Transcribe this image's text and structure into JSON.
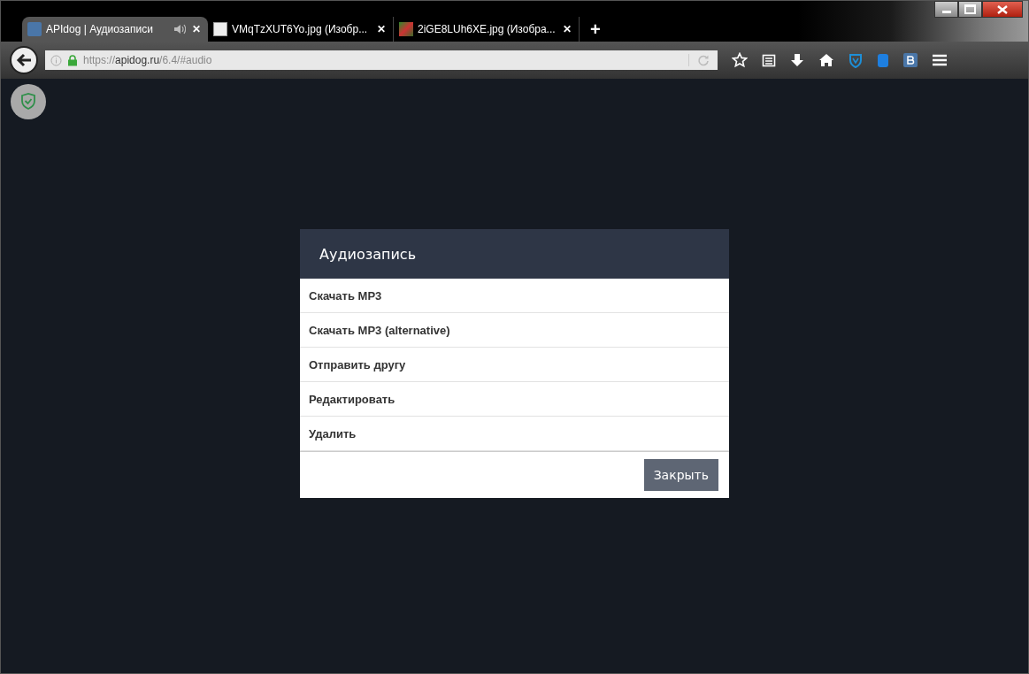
{
  "browser": {
    "tabs": [
      {
        "title": "APIdog | Аудиозаписи",
        "selected": true,
        "audio": true,
        "kind": "vk"
      },
      {
        "title": "VMqTzXUT6Yo.jpg (Изобр...",
        "selected": false,
        "audio": false,
        "kind": "image"
      },
      {
        "title": "2iGE8LUh6XE.jpg (Изобра...",
        "selected": false,
        "audio": false,
        "kind": "photo"
      }
    ],
    "new_tab": "+",
    "close_glyph": "✕",
    "address": {
      "scheme": "https://",
      "host": "apidog.ru",
      "path": "/6.4/#audio"
    }
  },
  "dialog": {
    "title": "Аудиозапись",
    "items": [
      "Скачать MP3",
      "Скачать MP3 (alternative)",
      "Отправить другу",
      "Редактировать",
      "Удалить"
    ],
    "close_button": "Закрыть"
  }
}
